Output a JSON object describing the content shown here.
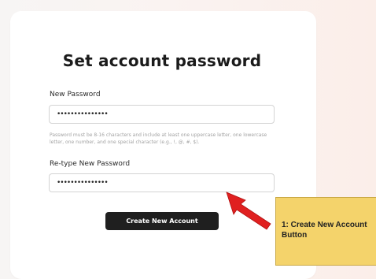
{
  "form": {
    "title": "Set account password",
    "new_password_label": "New Password",
    "new_password_value": "•••••••••••••••",
    "hint": "Password must be 8-16 characters and include at least one uppercase letter, one lowercase letter, one number, and one special character (e.g., !, @, #, $).",
    "retype_password_label": "Re-type New Password",
    "retype_password_value": "•••••••••••••••",
    "create_button_label": "Create New Account"
  },
  "annotation": {
    "text": "1: Create New Account  Button",
    "arrow_color": "#e02020",
    "callout_color": "#f4d36b"
  }
}
